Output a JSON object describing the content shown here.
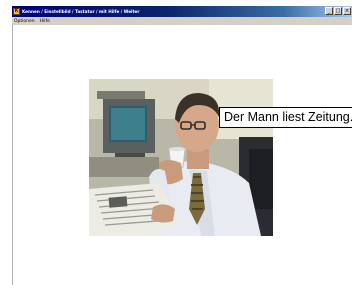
{
  "window": {
    "icon_letter": "K",
    "title": "Kennen / Einstellbild / Tastatur / mit Hilfe / Weiter",
    "buttons": {
      "minimize": "_",
      "maximize": "□",
      "close": "×"
    }
  },
  "menu": {
    "items": [
      "Optionen",
      "Hilfe"
    ]
  },
  "main": {
    "caption": "Der Mann liest Zeitung."
  },
  "colors": {
    "titlebar_start": "#000080",
    "titlebar_end": "#a6caf0",
    "menubar": "#d4d0c8"
  }
}
